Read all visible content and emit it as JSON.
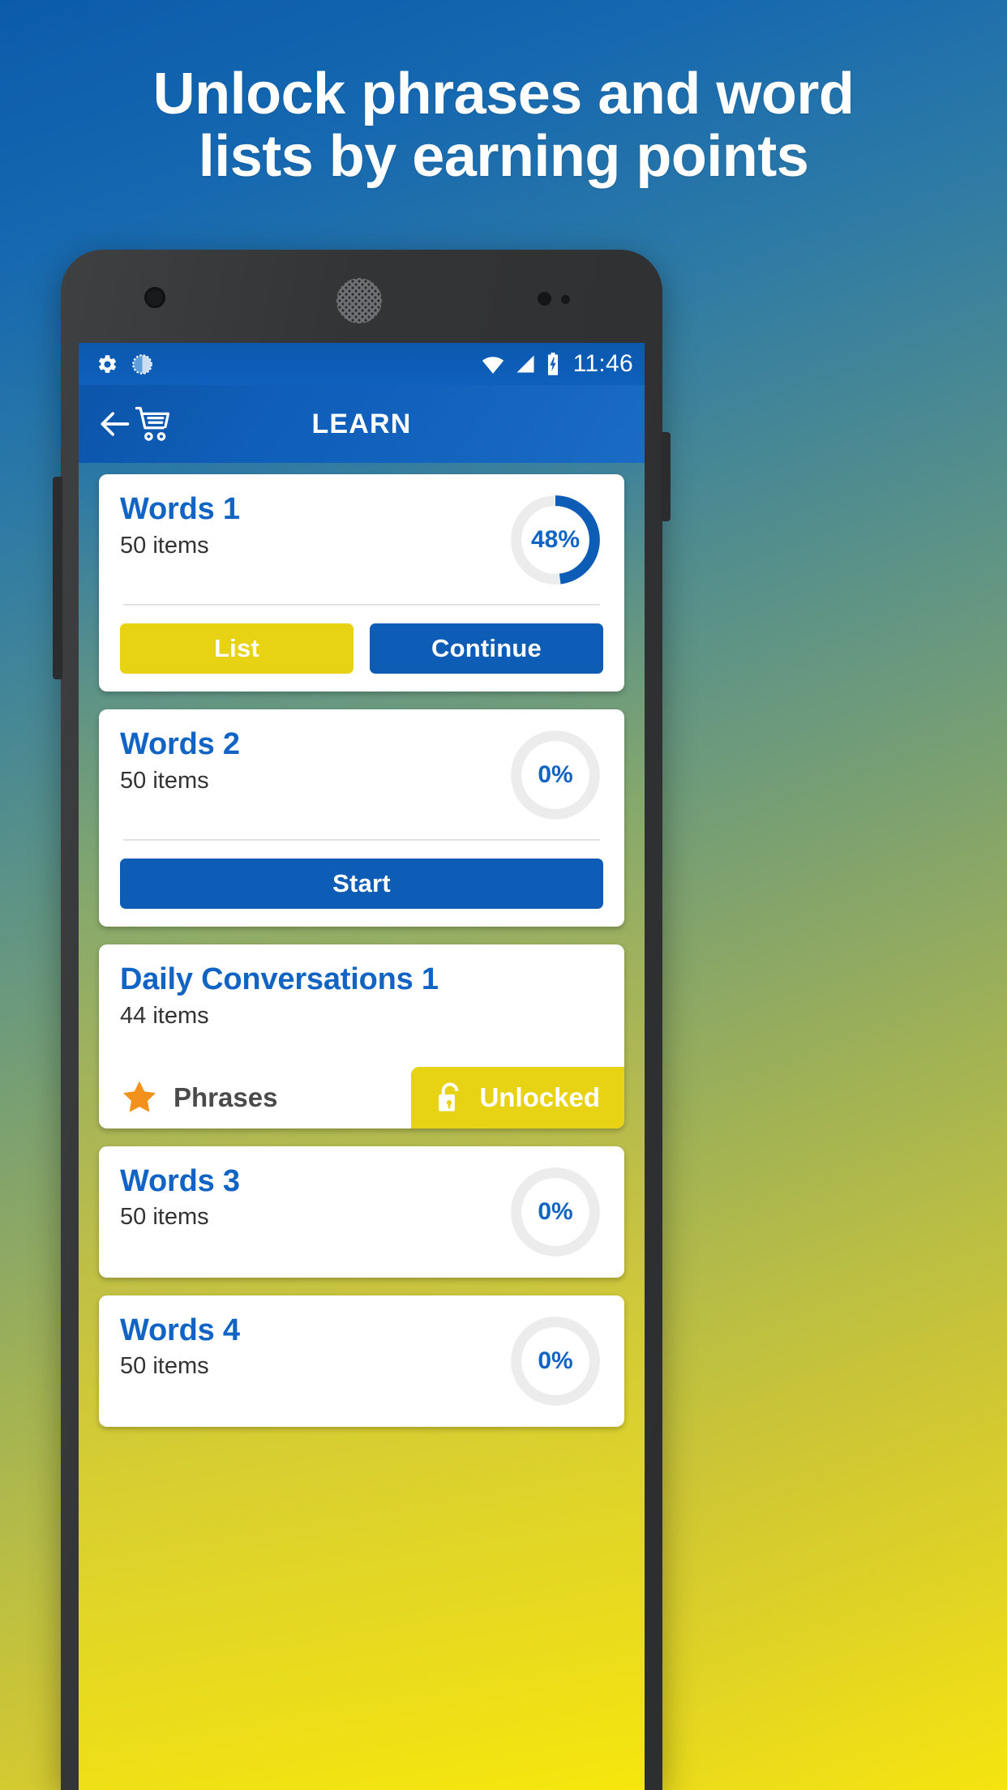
{
  "headline": {
    "line1": "Unlock phrases and word",
    "line2": "lists by earning points"
  },
  "colors": {
    "brand_blue": "#0d5cb6",
    "title_blue": "#1164c4",
    "accent_yellow": "#e8d214",
    "star_orange": "#f2921d",
    "card_white": "#ffffff",
    "bg_top": "#0b5bab",
    "bg_bottom": "#f5e40f"
  },
  "statusbar": {
    "time": "11:46",
    "left_icons": [
      "gear-icon",
      "download-progress-icon"
    ],
    "right_icons": [
      "wifi-icon",
      "signal-icon",
      "battery-charging-icon"
    ]
  },
  "toolbar": {
    "title": "LEARN",
    "back_icon": "back-arrow-icon",
    "cart_icon": "shopping-cart-icon"
  },
  "cards": [
    {
      "title": "Words 1",
      "subtitle": "50 items",
      "progress": 48,
      "progress_label": "48%",
      "buttons": [
        {
          "label": "List",
          "style": "yellow"
        },
        {
          "label": "Continue",
          "style": "blue"
        }
      ]
    },
    {
      "title": "Words 2",
      "subtitle": "50 items",
      "progress": 0,
      "progress_label": "0%",
      "buttons": [
        {
          "label": "Start",
          "style": "blue"
        }
      ]
    },
    {
      "title": "Daily Conversations 1",
      "subtitle": "44 items",
      "phrase_label": "Phrases",
      "phrase_icon": "star-icon",
      "unlock_label": "Unlocked",
      "unlock_icon": "open-padlock-icon"
    },
    {
      "title": "Words 3",
      "subtitle": "50 items",
      "progress": 0,
      "progress_label": "0%"
    },
    {
      "title": "Words 4",
      "subtitle": "50 items",
      "progress": 0,
      "progress_label": "0%"
    }
  ]
}
